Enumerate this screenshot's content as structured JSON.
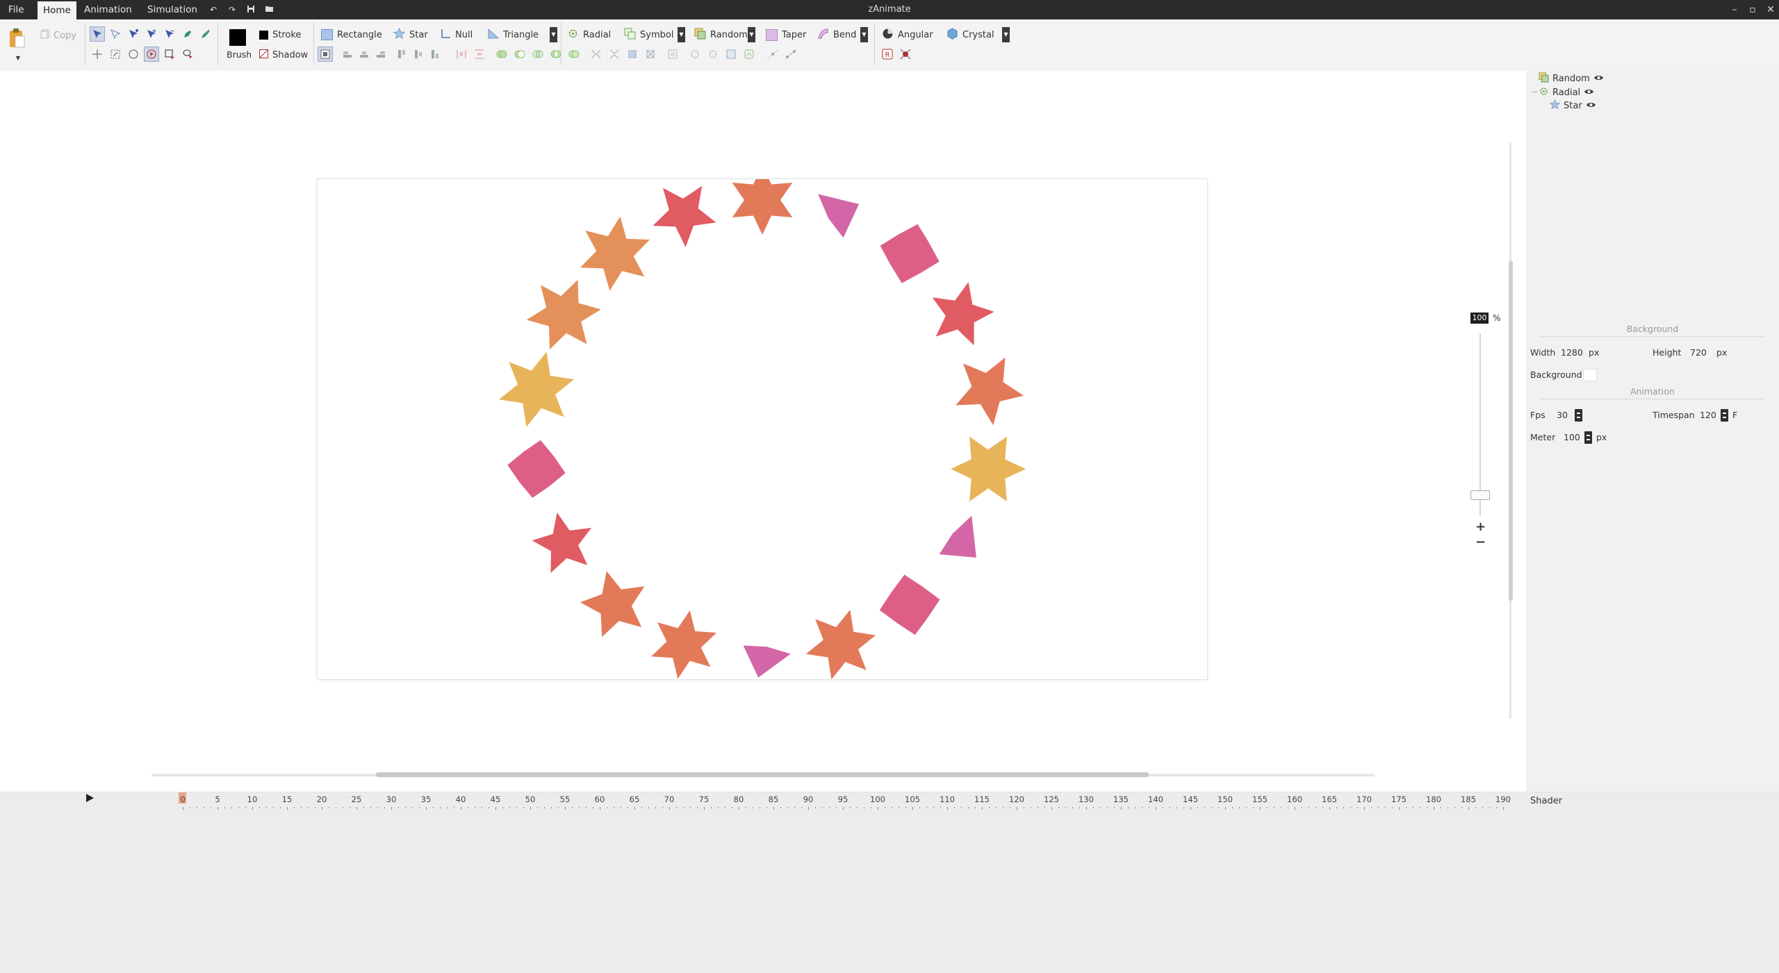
{
  "app": {
    "title": "zAnimate"
  },
  "menu": {
    "items": [
      "File",
      "Home",
      "Animation",
      "Simulation"
    ],
    "active": "Home"
  },
  "ribbon": {
    "clipboard": {
      "copy_label": "Copy"
    },
    "brush": {
      "brush_label": "Brush",
      "stroke_label": "Stroke",
      "shadow_label": "Shadow",
      "brush_color": "#000000"
    },
    "create": {
      "rectangle": "Rectangle",
      "star": "Star",
      "null": "Null",
      "triangle": "Triangle"
    },
    "modifiers": {
      "radial": "Radial",
      "symbol": "Symbol",
      "random": "Random",
      "taper": "Taper",
      "bend": "Bend"
    },
    "shaders": {
      "angular": "Angular",
      "crystal": "Crystal"
    }
  },
  "hierarchy": {
    "items": [
      {
        "label": "Random",
        "icon": "random-modifier-icon",
        "level": 0
      },
      {
        "label": "Radial",
        "icon": "radial-modifier-icon",
        "level": 0
      },
      {
        "label": "Star",
        "icon": "star-shape-icon",
        "level": 1
      }
    ]
  },
  "zoom": {
    "value": "100",
    "unit": "%"
  },
  "properties": {
    "background_header": "Background",
    "width_label": "Width",
    "width_value": "1280",
    "width_unit": "px",
    "height_label": "Height",
    "height_value": "720",
    "height_unit": "px",
    "background_label": "Background",
    "background_color": "#ffffff",
    "animation_header": "Animation",
    "fps_label": "Fps",
    "fps_value": "30",
    "timespan_label": "Timespan",
    "timespan_value": "120",
    "timespan_unit": "F",
    "meter_label": "Meter",
    "meter_value": "100",
    "meter_unit": "px"
  },
  "timeline": {
    "labels": [
      "0",
      "5",
      "10",
      "15",
      "20",
      "25",
      "30",
      "35",
      "40",
      "45",
      "50",
      "55",
      "60",
      "65",
      "70",
      "75",
      "80",
      "85",
      "90",
      "95",
      "100",
      "105",
      "110",
      "115",
      "120",
      "125",
      "130",
      "135",
      "140",
      "145",
      "150",
      "155",
      "160",
      "165",
      "170",
      "175",
      "180",
      "185",
      "190"
    ],
    "current_frame": "0",
    "shader_label": "Shader"
  },
  "colors": {
    "coral": "#e27a5a",
    "red": "#e05b62",
    "orange": "#e4905a",
    "yellow": "#e8b45a",
    "pink": "#dd5f86",
    "magenta": "#d366a6"
  }
}
